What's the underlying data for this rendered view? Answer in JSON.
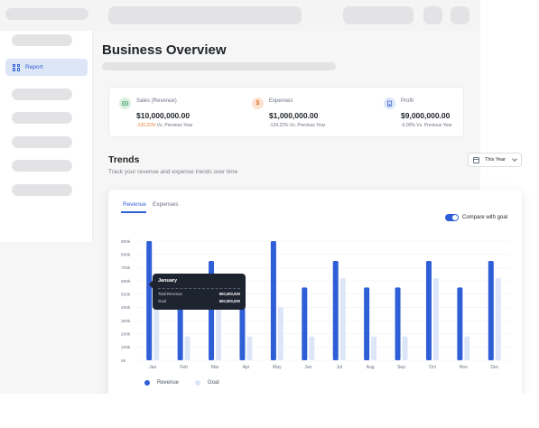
{
  "page": {
    "title": "Business Overview"
  },
  "sidebar": {
    "active_item": {
      "label": "Report",
      "icon": "grid-icon"
    }
  },
  "stats": [
    {
      "label": "Sales (Revenue)",
      "value": "$10,000,000.00",
      "delta": "-120.22%",
      "delta_suffix": " Vs. Previous Year",
      "icon": "money-icon",
      "icon_color": "#3c9a5f",
      "icon_bg": "#d9eedf",
      "delta_color": "#ea7a28"
    },
    {
      "label": "Expenses",
      "value": "$1,000,000.00",
      "delta": "-134.22%",
      "delta_suffix": " Vs. Previous Year",
      "icon": "dollar-icon",
      "icon_color": "#e0742f",
      "icon_bg": "#fde3d2",
      "delta_color": "#6b7280"
    },
    {
      "label": "Profit",
      "value": "$9,000,000.00",
      "delta": "-0.00%",
      "delta_suffix": " Vs. Previous Year",
      "icon": "building-icon",
      "icon_color": "#4a6fd1",
      "icon_bg": "#dce5f8",
      "delta_color": "#6b7280"
    }
  ],
  "trends": {
    "title": "Trends",
    "subtitle": "Track your revenue and expense trends over time",
    "range_label": "This Year"
  },
  "chart_card": {
    "tabs": [
      "Revenue",
      "Expenses"
    ],
    "active_tab": "Revenue",
    "toggle_label": "Compare with goal",
    "toggle_on": true,
    "legend": [
      {
        "name": "Revenue",
        "color": "#2f5fd6"
      },
      {
        "name": "Goal",
        "color": "#dde6f8"
      }
    ],
    "tooltip": {
      "title": "January",
      "rows": [
        {
          "label": "Total Revenue",
          "value": "900,000,000"
        },
        {
          "label": "Goal",
          "value": "500,000,000"
        }
      ]
    }
  },
  "chart_data": {
    "type": "bar",
    "categories": [
      "Jan",
      "Feb",
      "Mar",
      "Apr",
      "May",
      "Jun",
      "Jul",
      "Aug",
      "Sep",
      "Oct",
      "Nov",
      "Dec"
    ],
    "series": [
      {
        "name": "Revenue",
        "color": "#2f5fd6",
        "values": [
          900,
          500,
          750,
          550,
          900,
          550,
          750,
          550,
          550,
          750,
          550,
          750
        ]
      },
      {
        "name": "Goal",
        "color": "#dde6f8",
        "values": [
          500,
          180,
          400,
          180,
          400,
          180,
          620,
          180,
          180,
          620,
          180,
          620
        ]
      }
    ],
    "yticks": [
      "0k",
      "100k",
      "200k",
      "300k",
      "400k",
      "500k",
      "600k",
      "700k",
      "800k",
      "900k"
    ],
    "ylim": [
      0,
      900
    ],
    "grid": true
  }
}
